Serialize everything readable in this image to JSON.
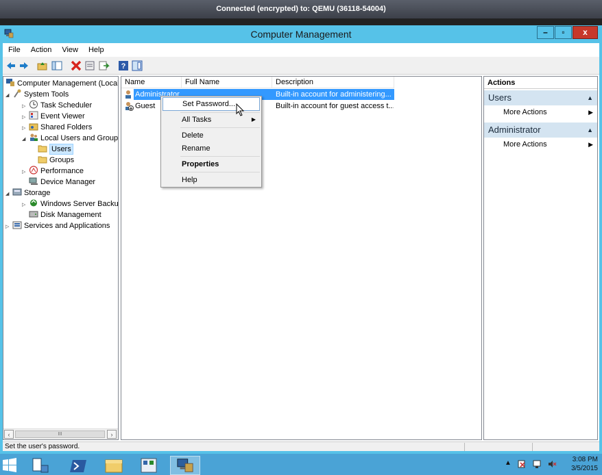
{
  "remote": {
    "connection_text": "Connected (encrypted) to: QEMU (36118-54004)"
  },
  "window": {
    "title": "Computer Management",
    "buttons": {
      "minimize": "–",
      "maximize": "▫",
      "close": "x"
    }
  },
  "menubar": [
    "File",
    "Action",
    "View",
    "Help"
  ],
  "toolbar_icons": [
    "back-icon",
    "forward-icon",
    "up-folder-icon",
    "show-hide-tree-icon",
    "delete-icon",
    "properties-icon",
    "export-icon",
    "help-icon",
    "action-pane-icon"
  ],
  "tree": {
    "items": [
      {
        "label": "Computer Management (Local",
        "expander": "",
        "icon": "computer-management-icon"
      },
      {
        "label": "System Tools",
        "expander": "◢",
        "icon": "tools-icon"
      },
      {
        "label": "Task Scheduler",
        "expander": "▷",
        "icon": "clock-icon"
      },
      {
        "label": "Event Viewer",
        "expander": "▷",
        "icon": "event-viewer-icon"
      },
      {
        "label": "Shared Folders",
        "expander": "▷",
        "icon": "shared-folder-icon"
      },
      {
        "label": "Local Users and Groups",
        "expander": "◢",
        "icon": "users-groups-icon"
      },
      {
        "label": "Users",
        "expander": "",
        "icon": "folder-icon"
      },
      {
        "label": "Groups",
        "expander": "",
        "icon": "folder-icon"
      },
      {
        "label": "Performance",
        "expander": "▷",
        "icon": "performance-icon"
      },
      {
        "label": "Device Manager",
        "expander": "",
        "icon": "device-manager-icon"
      },
      {
        "label": "Storage",
        "expander": "◢",
        "icon": "storage-icon"
      },
      {
        "label": "Windows Server Backup",
        "expander": "▷",
        "icon": "backup-icon"
      },
      {
        "label": "Disk Management",
        "expander": "",
        "icon": "disk-icon"
      },
      {
        "label": "Services and Applications",
        "expander": "▷",
        "icon": "services-icon"
      }
    ],
    "scroll_thumb": "III"
  },
  "list": {
    "columns": [
      "Name",
      "Full Name",
      "Description"
    ],
    "rows": [
      {
        "name": "Administrator",
        "full_name": "",
        "description": "Built-in account for administering..."
      },
      {
        "name": "Guest",
        "full_name": "",
        "description": "Built-in account for guest access t..."
      }
    ]
  },
  "context_menu": {
    "items": [
      "Set Password...",
      "All Tasks",
      "Delete",
      "Rename",
      "Properties",
      "Help"
    ]
  },
  "actions": {
    "title": "Actions",
    "groups": [
      {
        "label": "Users",
        "item": "More Actions"
      },
      {
        "label": "Administrator",
        "item": "More Actions"
      }
    ]
  },
  "status": {
    "text": "Set the user's password."
  },
  "taskbar": {
    "clock_time": "3:08 PM",
    "clock_date": "3/5/2015"
  },
  "colors": {
    "accent": "#56c2e8",
    "selection": "#3399ff",
    "taskbar": "#4aa3d6"
  }
}
